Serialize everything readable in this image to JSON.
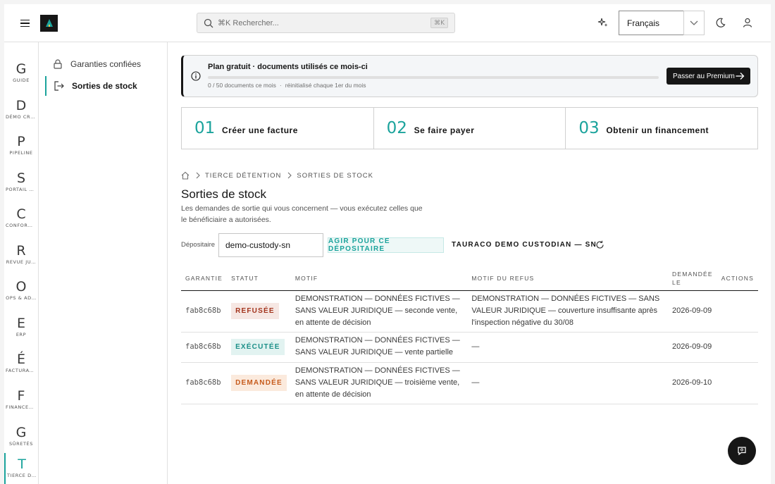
{
  "header": {
    "search_placeholder": "⌘K Rechercher...",
    "search_shortcut": "⌘K",
    "language": "Français"
  },
  "rail": [
    {
      "letter": "G",
      "label": "GUIDE",
      "active": false
    },
    {
      "letter": "D",
      "label": "DÉMO CRUD",
      "active": false
    },
    {
      "letter": "P",
      "label": "PIPELINE",
      "active": false
    },
    {
      "letter": "S",
      "label": "PORTAIL V…",
      "active": false
    },
    {
      "letter": "C",
      "label": "CONFORM…",
      "active": false
    },
    {
      "letter": "R",
      "label": "REVUE JU…",
      "active": false
    },
    {
      "letter": "O",
      "label": "OPS & AD…",
      "active": false
    },
    {
      "letter": "E",
      "label": "ERP",
      "active": false
    },
    {
      "letter": "É",
      "label": "FACTURAT…",
      "active": false
    },
    {
      "letter": "F",
      "label": "FINANCEM…",
      "active": false
    },
    {
      "letter": "G",
      "label": "SÛRETÉS",
      "active": false
    },
    {
      "letter": "T",
      "label": "TIERCE DÉ…",
      "active": true
    }
  ],
  "subnav": [
    {
      "label": "Garanties confiées",
      "active": false
    },
    {
      "label": "Sorties de stock",
      "active": true
    }
  ],
  "plan": {
    "title": "Plan gratuit · documents utilisés ce mois-ci",
    "usage": "0 / 50 documents ce mois",
    "separator": "·",
    "reset": "réinitialisé chaque 1er du mois",
    "progress_percent": 0,
    "cta": "Passer au Premium"
  },
  "steps": [
    {
      "num": "01",
      "label": "Créer une facture"
    },
    {
      "num": "02",
      "label": "Se faire payer"
    },
    {
      "num": "03",
      "label": "Obtenir un financement"
    }
  ],
  "breadcrumb": [
    "TIERCE DÉTENTION",
    "SORTIES DE STOCK"
  ],
  "page": {
    "title": "Sorties de stock",
    "description": "Les demandes de sortie qui vous concernent — vous exécutez celles que le bénéficiaire a autorisées."
  },
  "depositary": {
    "label": "Dépositaire",
    "value": "demo-custody-sn",
    "action": "AGIR POUR CE DÉPOSITAIRE",
    "name": "TAURACO DEMO CUSTODIAN — SN"
  },
  "table": {
    "headers": [
      "GARANTIE",
      "STATUT",
      "MOTIF",
      "MOTIF DU REFUS",
      "DEMANDÉE LE",
      "ACTIONS"
    ],
    "rows": [
      {
        "guarantee": "fab8c68b",
        "status": "REFUSÉE",
        "reason": "DEMONSTRATION — DONNÉES FICTIVES — SANS VALEUR JURIDIQUE — seconde vente, en attente de décision",
        "refusal_reason": "DEMONSTRATION — DONNÉES FICTIVES — SANS VALEUR JURIDIQUE — couverture insuffisante après l'inspection négative du 30/08",
        "requested_on": "2026-09-09",
        "actions": ""
      },
      {
        "guarantee": "fab8c68b",
        "status": "EXÉCUTÉE",
        "reason": "DEMONSTRATION — DONNÉES FICTIVES — SANS VALEUR JURIDIQUE — vente partielle",
        "refusal_reason": "—",
        "requested_on": "2026-09-09",
        "actions": ""
      },
      {
        "guarantee": "fab8c68b",
        "status": "DEMANDÉE",
        "reason": "DEMONSTRATION — DONNÉES FICTIVES — SANS VALEUR JURIDIQUE — troisième vente, en attente de décision",
        "refusal_reason": "—",
        "requested_on": "2026-09-10",
        "actions": ""
      }
    ]
  },
  "colors": {
    "accent": "#1ba39c",
    "primary_button": "#161616",
    "refused": "#a2331c",
    "executed": "#1b8f88",
    "requested": "#c65b1c"
  },
  "icons": {
    "menu": "hamburger-icon",
    "logo": "app-logo",
    "search": "search-icon",
    "ai": "sparkle-icon",
    "theme": "moon-icon",
    "user": "user-icon",
    "lock": "lock-icon",
    "exit": "exit-icon",
    "info": "info-icon",
    "arrow": "arrow-right-icon",
    "home": "home-icon",
    "refresh": "refresh-icon",
    "chat": "chat-icon"
  }
}
